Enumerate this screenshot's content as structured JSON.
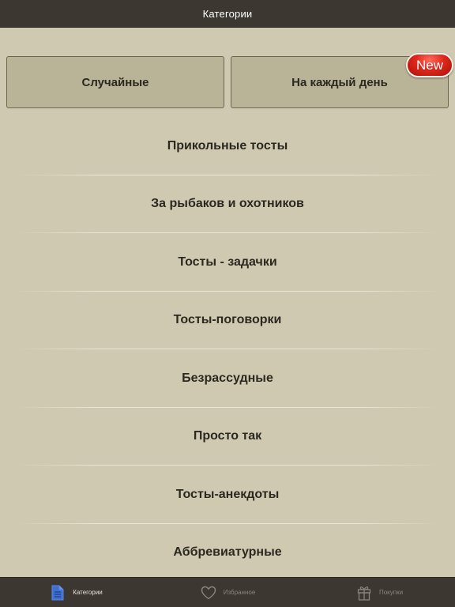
{
  "navbar": {
    "title": "Категории"
  },
  "top_buttons": {
    "random_label": "Случайные",
    "daily_label": "На каждый день",
    "new_badge": "New"
  },
  "categories": [
    {
      "label": "Прикольные тосты"
    },
    {
      "label": "За рыбаков и охотников"
    },
    {
      "label": "Тосты - задачки"
    },
    {
      "label": "Тосты-поговорки"
    },
    {
      "label": "Безрассудные"
    },
    {
      "label": "Просто так"
    },
    {
      "label": "Тосты-анекдоты"
    },
    {
      "label": "Аббревиатурные"
    }
  ],
  "tabbar": {
    "tabs": [
      {
        "label": "Категории",
        "icon": "document-icon",
        "active": true
      },
      {
        "label": "Избранное",
        "icon": "heart-icon",
        "active": false
      },
      {
        "label": "Покупки",
        "icon": "gift-icon",
        "active": false
      }
    ]
  },
  "colors": {
    "bar_background": "#3c3731",
    "content_background": "#d0c9b1",
    "button_background": "#b9b397",
    "active_icon": "#3f6fcf",
    "badge_red": "#e0281c"
  }
}
